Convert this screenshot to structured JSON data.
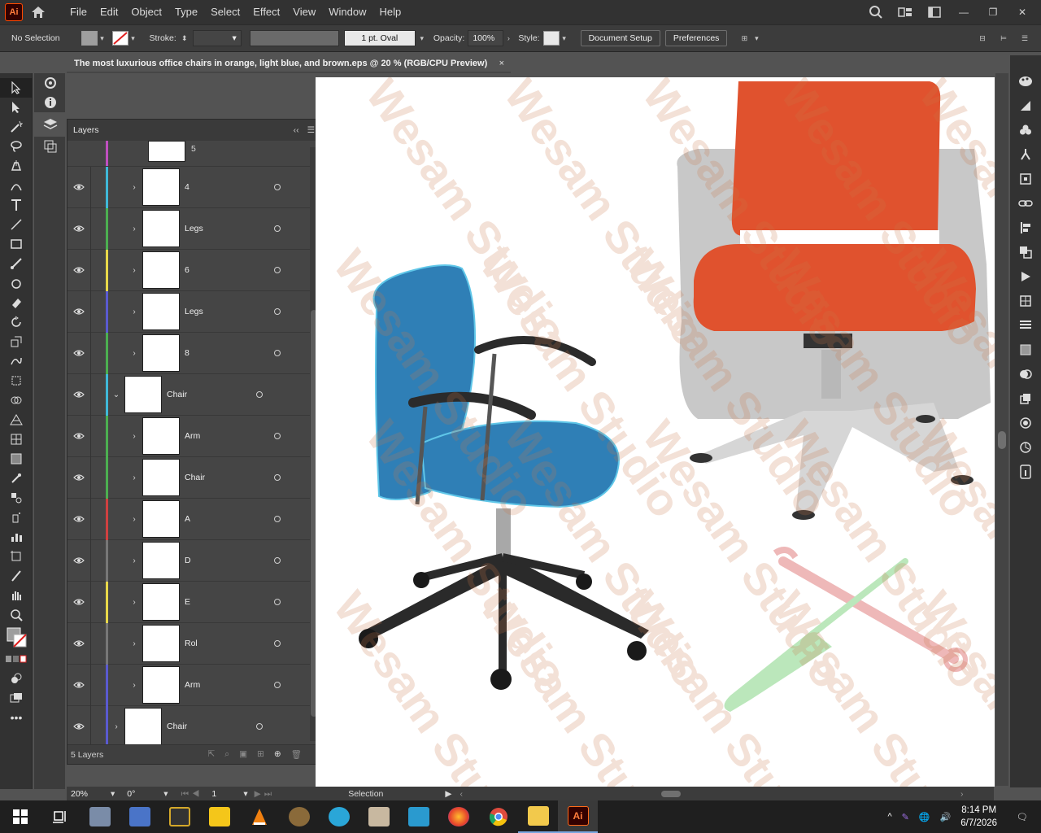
{
  "app": {
    "logo": "Ai"
  },
  "menu": [
    "File",
    "Edit",
    "Object",
    "Type",
    "Select",
    "Effect",
    "View",
    "Window",
    "Help"
  ],
  "control": {
    "selection": "No Selection",
    "stroke_label": "Stroke:",
    "brush": "1 pt. Oval",
    "opacity_label": "Opacity:",
    "opacity_value": "100%",
    "style_label": "Style:",
    "doc_setup": "Document Setup",
    "preferences": "Preferences"
  },
  "document": {
    "tab_title": "The most luxurious office chairs in orange, light blue, and brown.eps @ 20 % (RGB/CPU Preview)",
    "close": "×"
  },
  "layers_panel": {
    "title": "Layers",
    "count": "5 Layers",
    "rows": [
      {
        "name": "4",
        "color": "#3fb8d8",
        "expanded": false,
        "level": 2
      },
      {
        "name": "Legs",
        "color": "#4caf50",
        "expanded": false,
        "level": 2
      },
      {
        "name": "6",
        "color": "#e8d84a",
        "expanded": false,
        "level": 2
      },
      {
        "name": "Legs",
        "color": "#5a5ad0",
        "expanded": false,
        "level": 2
      },
      {
        "name": "8",
        "color": "#4caf50",
        "expanded": false,
        "level": 2
      },
      {
        "name": "Chair",
        "color": "#3fb8d8",
        "expanded": true,
        "level": 1
      },
      {
        "name": "Arm",
        "color": "#4caf50",
        "expanded": false,
        "level": 2
      },
      {
        "name": "Chair",
        "color": "#4caf50",
        "expanded": false,
        "level": 2
      },
      {
        "name": "A",
        "color": "#d04040",
        "expanded": false,
        "level": 2
      },
      {
        "name": "D",
        "color": "#777777",
        "expanded": false,
        "level": 2
      },
      {
        "name": "E",
        "color": "#e8d84a",
        "expanded": false,
        "level": 2
      },
      {
        "name": "Rol",
        "color": "#777777",
        "expanded": false,
        "level": 2
      },
      {
        "name": "Arm",
        "color": "#5a5ad0",
        "expanded": false,
        "level": 2
      },
      {
        "name": "Chair",
        "color": "#5a5ad0",
        "expanded": false,
        "level": 1
      }
    ],
    "partial_top_label": "5"
  },
  "status": {
    "zoom": "20%",
    "rotation": "0°",
    "artboard": "1",
    "tool": "Selection"
  },
  "watermark": "Wesam Studio",
  "taskbar": {
    "time": "8:14 PM",
    "date": "6/7/2026",
    "apps": [
      "file-explorer-alt",
      "snipping-tool",
      "media-studio",
      "player",
      "vlc",
      "gimp",
      "photo-app",
      "paint",
      "video-editor",
      "firefox",
      "chrome",
      "folder",
      "illustrator"
    ]
  }
}
